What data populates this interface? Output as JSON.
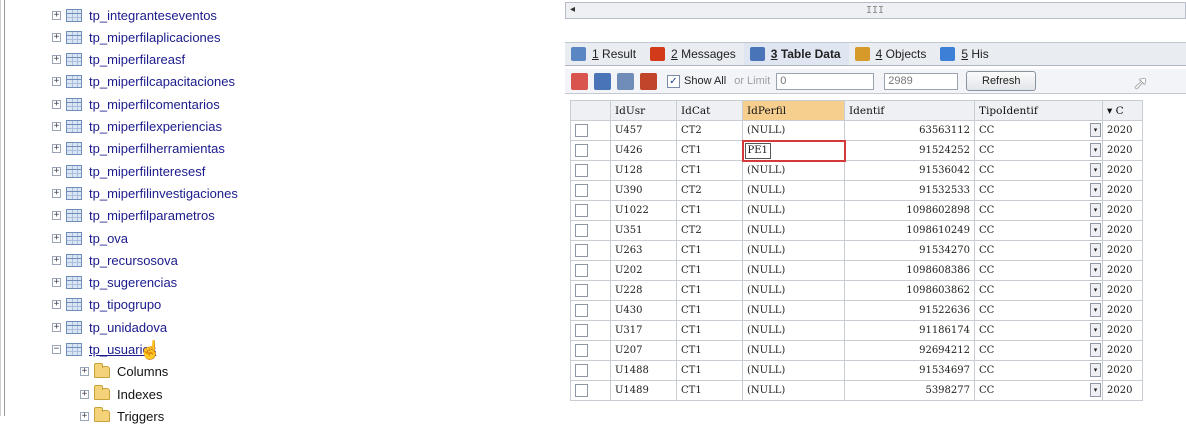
{
  "tree": {
    "items": [
      {
        "label": "tp_integranteseventos",
        "expander": "+",
        "icon": "table-icon"
      },
      {
        "label": "tp_miperfilaplicaciones",
        "expander": "+",
        "icon": "table-icon"
      },
      {
        "label": "tp_miperfilareasf",
        "expander": "+",
        "icon": "table-icon"
      },
      {
        "label": "tp_miperfilcapacitaciones",
        "expander": "+",
        "icon": "table-icon"
      },
      {
        "label": "tp_miperfilcomentarios",
        "expander": "+",
        "icon": "table-icon"
      },
      {
        "label": "tp_miperfilexperiencias",
        "expander": "+",
        "icon": "table-icon"
      },
      {
        "label": "tp_miperfilherramientas",
        "expander": "+",
        "icon": "table-icon"
      },
      {
        "label": "tp_miperfilinteresesf",
        "expander": "+",
        "icon": "table-icon"
      },
      {
        "label": "tp_miperfilinvestigaciones",
        "expander": "+",
        "icon": "table-icon"
      },
      {
        "label": "tp_miperfilparametros",
        "expander": "+",
        "icon": "table-icon"
      },
      {
        "label": "tp_ova",
        "expander": "+",
        "icon": "table-icon"
      },
      {
        "label": "tp_recursosova",
        "expander": "+",
        "icon": "table-icon"
      },
      {
        "label": "tp_sugerencias",
        "expander": "+",
        "icon": "table-icon"
      },
      {
        "label": "tp_tipogrupo",
        "expander": "+",
        "icon": "table-icon"
      },
      {
        "label": "tp_unidadova",
        "expander": "+",
        "icon": "table-icon"
      },
      {
        "label": "tp_usuarios",
        "expander": "−",
        "icon": "table-icon"
      }
    ],
    "children": [
      {
        "label": "Columns",
        "expander": "+",
        "icon": "folder-icon"
      },
      {
        "label": "Indexes",
        "expander": "+",
        "icon": "folder-icon"
      },
      {
        "label": "Triggers",
        "expander": "+",
        "icon": "folder-icon"
      }
    ]
  },
  "hscroll": {
    "arrow": "◂",
    "grip": "III"
  },
  "tabs": [
    {
      "num": "1",
      "label": "Result",
      "color": "#5b86c4"
    },
    {
      "num": "2",
      "label": "Messages",
      "color": "#d23a1a"
    },
    {
      "num": "3",
      "label": "Table Data",
      "color": "#4a74b8"
    },
    {
      "num": "4",
      "label": "Objects",
      "color": "#d69a2a"
    },
    {
      "num": "5",
      "label": "His",
      "color": "#3b7fd6"
    }
  ],
  "toolbar": {
    "show_all_label": "Show All",
    "show_all_checked": "✓",
    "limit_label": "or Limit",
    "limit_from": "0",
    "limit_count": "2989",
    "refresh_label": "Refresh"
  },
  "grid": {
    "columns": [
      "IdUsr",
      "IdCat",
      "IdPerfil",
      "Identif",
      "TipoIdentif",
      "▾ C"
    ],
    "highlight_column": "IdPerfil",
    "rows": [
      {
        "id": "U457",
        "cat": "CT2",
        "perfil": "(NULL)",
        "identif": "63563112",
        "tipo": "CC",
        "c": "2020"
      },
      {
        "id": "U426",
        "cat": "CT1",
        "perfil": "PE1",
        "identif": "91524252",
        "tipo": "CC",
        "c": "2020"
      },
      {
        "id": "U128",
        "cat": "CT1",
        "perfil": "(NULL)",
        "identif": "91536042",
        "tipo": "CC",
        "c": "2020"
      },
      {
        "id": "U390",
        "cat": "CT2",
        "perfil": "(NULL)",
        "identif": "91532533",
        "tipo": "CC",
        "c": "2020"
      },
      {
        "id": "U1022",
        "cat": "CT1",
        "perfil": "(NULL)",
        "identif": "1098602898",
        "tipo": "CC",
        "c": "2020"
      },
      {
        "id": "U351",
        "cat": "CT2",
        "perfil": "(NULL)",
        "identif": "1098610249",
        "tipo": "CC",
        "c": "2020"
      },
      {
        "id": "U263",
        "cat": "CT1",
        "perfil": "(NULL)",
        "identif": "91534270",
        "tipo": "CC",
        "c": "2020"
      },
      {
        "id": "U202",
        "cat": "CT1",
        "perfil": "(NULL)",
        "identif": "1098608386",
        "tipo": "CC",
        "c": "2020"
      },
      {
        "id": "U228",
        "cat": "CT1",
        "perfil": "(NULL)",
        "identif": "1098603862",
        "tipo": "CC",
        "c": "2020"
      },
      {
        "id": "U430",
        "cat": "CT1",
        "perfil": "(NULL)",
        "identif": "91522636",
        "tipo": "CC",
        "c": "2020"
      },
      {
        "id": "U317",
        "cat": "CT1",
        "perfil": "(NULL)",
        "identif": "91186174",
        "tipo": "CC",
        "c": "2020"
      },
      {
        "id": "U207",
        "cat": "CT1",
        "perfil": "(NULL)",
        "identif": "92694212",
        "tipo": "CC",
        "c": "2020"
      },
      {
        "id": "U1488",
        "cat": "CT1",
        "perfil": "(NULL)",
        "identif": "91534697",
        "tipo": "CC",
        "c": "2020"
      },
      {
        "id": "U1489",
        "cat": "CT1",
        "perfil": "(NULL)",
        "identif": "5398277",
        "tipo": "CC",
        "c": "2020"
      }
    ],
    "editing_row": 1,
    "dropdown_glyph": "▾"
  }
}
